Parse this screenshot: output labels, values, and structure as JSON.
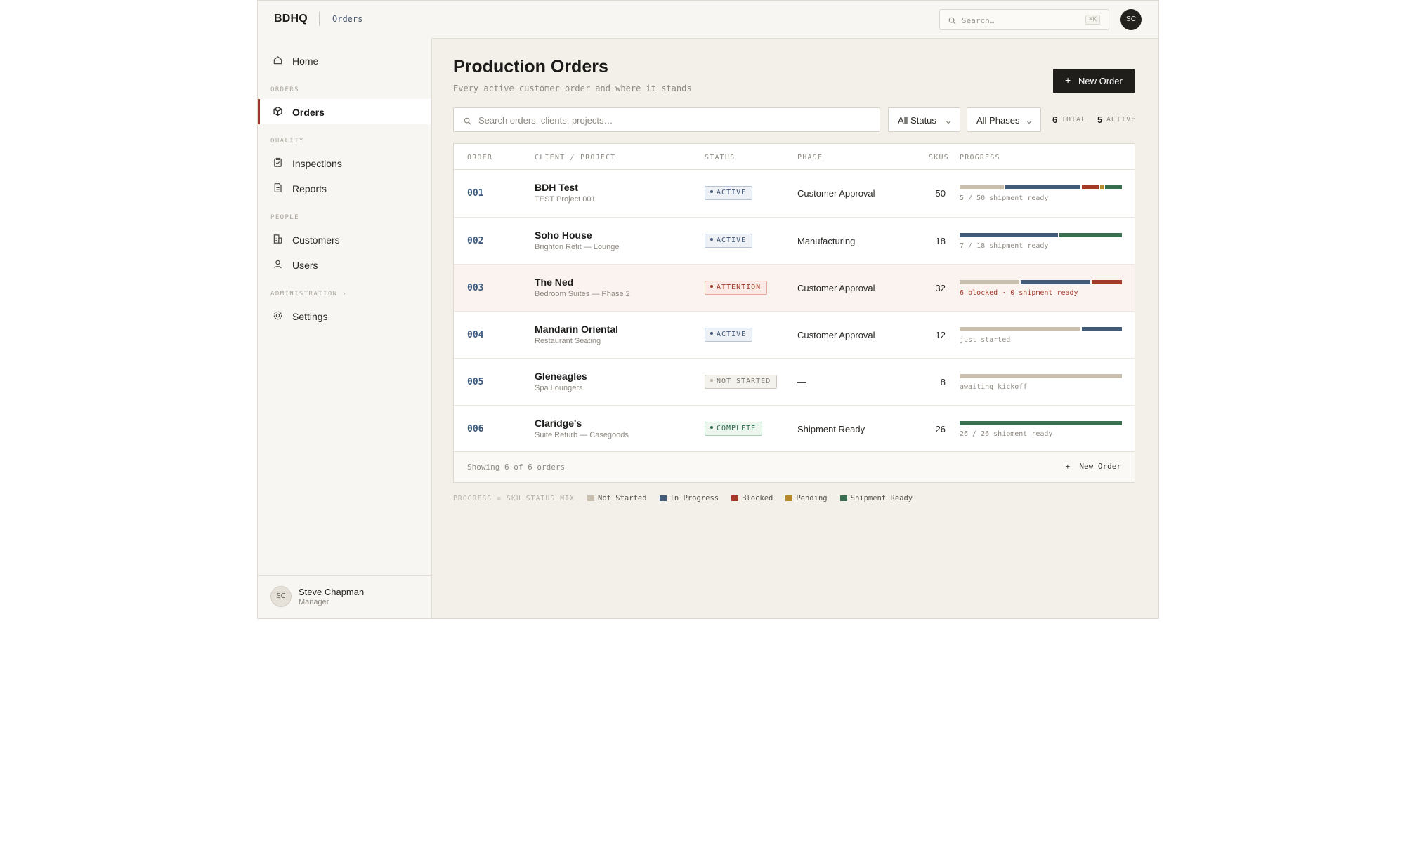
{
  "header": {
    "logo": "BDHQ",
    "breadcrumb": "Orders",
    "search_placeholder": "Search…",
    "search_shortcut": "⌘K",
    "avatar_initials": "SC"
  },
  "sidebar": {
    "home": "Home",
    "sections": {
      "orders": "ORDERS",
      "quality": "QUALITY",
      "people": "PEOPLE",
      "administration": "ADMINISTRATION ›"
    },
    "items": {
      "orders": "Orders",
      "inspections": "Inspections",
      "reports": "Reports",
      "customers": "Customers",
      "users": "Users",
      "settings": "Settings"
    },
    "active_item": "Orders",
    "user": {
      "initials": "SC",
      "name": "Steve Chapman",
      "role": "Manager"
    }
  },
  "main": {
    "title": "Production Orders",
    "subtitle": "Every active customer order and where it stands",
    "new_order_label": "New Order",
    "search_placeholder": "Search orders, clients, projects…",
    "status_filter": "All Status",
    "phase_filter": "All Phases",
    "stats": {
      "total": "6",
      "total_label": "TOTAL",
      "active": "5",
      "active_label": "ACTIVE"
    },
    "table": {
      "columns": {
        "order": "ORDER",
        "client": "CLIENT / PROJECT",
        "status": "STATUS",
        "phase": "PHASE",
        "skus": "SKUS",
        "progress": "PROGRESS"
      },
      "rows": [
        {
          "id": "001",
          "client": "BDH Test",
          "project": "TEST Project 001",
          "status": "ACTIVE",
          "phase": "Customer Approval",
          "skus": "50",
          "progress_text": "5 / 50 shipment ready",
          "mix": {
            "not_started": 13,
            "in_progress": 22,
            "blocked": 5,
            "pending": 1,
            "shipment_ready": 5
          }
        },
        {
          "id": "002",
          "client": "Soho House",
          "project": "Brighton Refit — Lounge",
          "status": "ACTIVE",
          "phase": "Manufacturing",
          "skus": "18",
          "progress_text": "7 / 18 shipment ready",
          "mix": {
            "not_started": 0,
            "in_progress": 11,
            "blocked": 0,
            "pending": 0,
            "shipment_ready": 7
          }
        },
        {
          "id": "003",
          "client": "The Ned",
          "project": "Bedroom Suites — Phase 2",
          "status": "ATTENTION",
          "phase": "Customer Approval",
          "skus": "32",
          "progress_text": "6 blocked · 0 shipment ready",
          "mix": {
            "not_started": 12,
            "in_progress": 14,
            "blocked": 6,
            "pending": 0,
            "shipment_ready": 0
          }
        },
        {
          "id": "004",
          "client": "Mandarin Oriental",
          "project": "Restaurant Seating",
          "status": "ACTIVE",
          "phase": "Customer Approval",
          "skus": "12",
          "progress_text": "just started",
          "mix": {
            "not_started": 9,
            "in_progress": 3,
            "blocked": 0,
            "pending": 0,
            "shipment_ready": 0
          }
        },
        {
          "id": "005",
          "client": "Gleneagles",
          "project": "Spa Loungers",
          "status": "NOT STARTED",
          "phase": "—",
          "skus": "8",
          "progress_text": "awaiting kickoff",
          "mix": {
            "not_started": 8,
            "in_progress": 0,
            "blocked": 0,
            "pending": 0,
            "shipment_ready": 0
          }
        },
        {
          "id": "006",
          "client": "Claridge's",
          "project": "Suite Refurb — Casegoods",
          "status": "COMPLETE",
          "phase": "Shipment Ready",
          "skus": "26",
          "progress_text": "26 / 26 shipment ready",
          "mix": {
            "not_started": 0,
            "in_progress": 0,
            "blocked": 0,
            "pending": 0,
            "shipment_ready": 26
          }
        }
      ],
      "footer_count": "Showing 6 of 6 orders",
      "footer_new_order": "New Order"
    },
    "legend": {
      "title": "PROGRESS = SKU STATUS MIX",
      "items": [
        {
          "key": "not_started",
          "label": "Not Started",
          "color": "#c9bfae"
        },
        {
          "key": "in_progress",
          "label": "In Progress",
          "color": "#425b78"
        },
        {
          "key": "blocked",
          "label": "Blocked",
          "color": "#a33a28"
        },
        {
          "key": "pending",
          "label": "Pending",
          "color": "#b8882c"
        },
        {
          "key": "shipment_ready",
          "label": "Shipment Ready",
          "color": "#3a6e50"
        }
      ]
    }
  },
  "colors": {
    "accent": "#9a3b2a",
    "primary_button": "#1f1e1b",
    "order_id": "#3d5a80",
    "background": "#f3f0ea"
  }
}
